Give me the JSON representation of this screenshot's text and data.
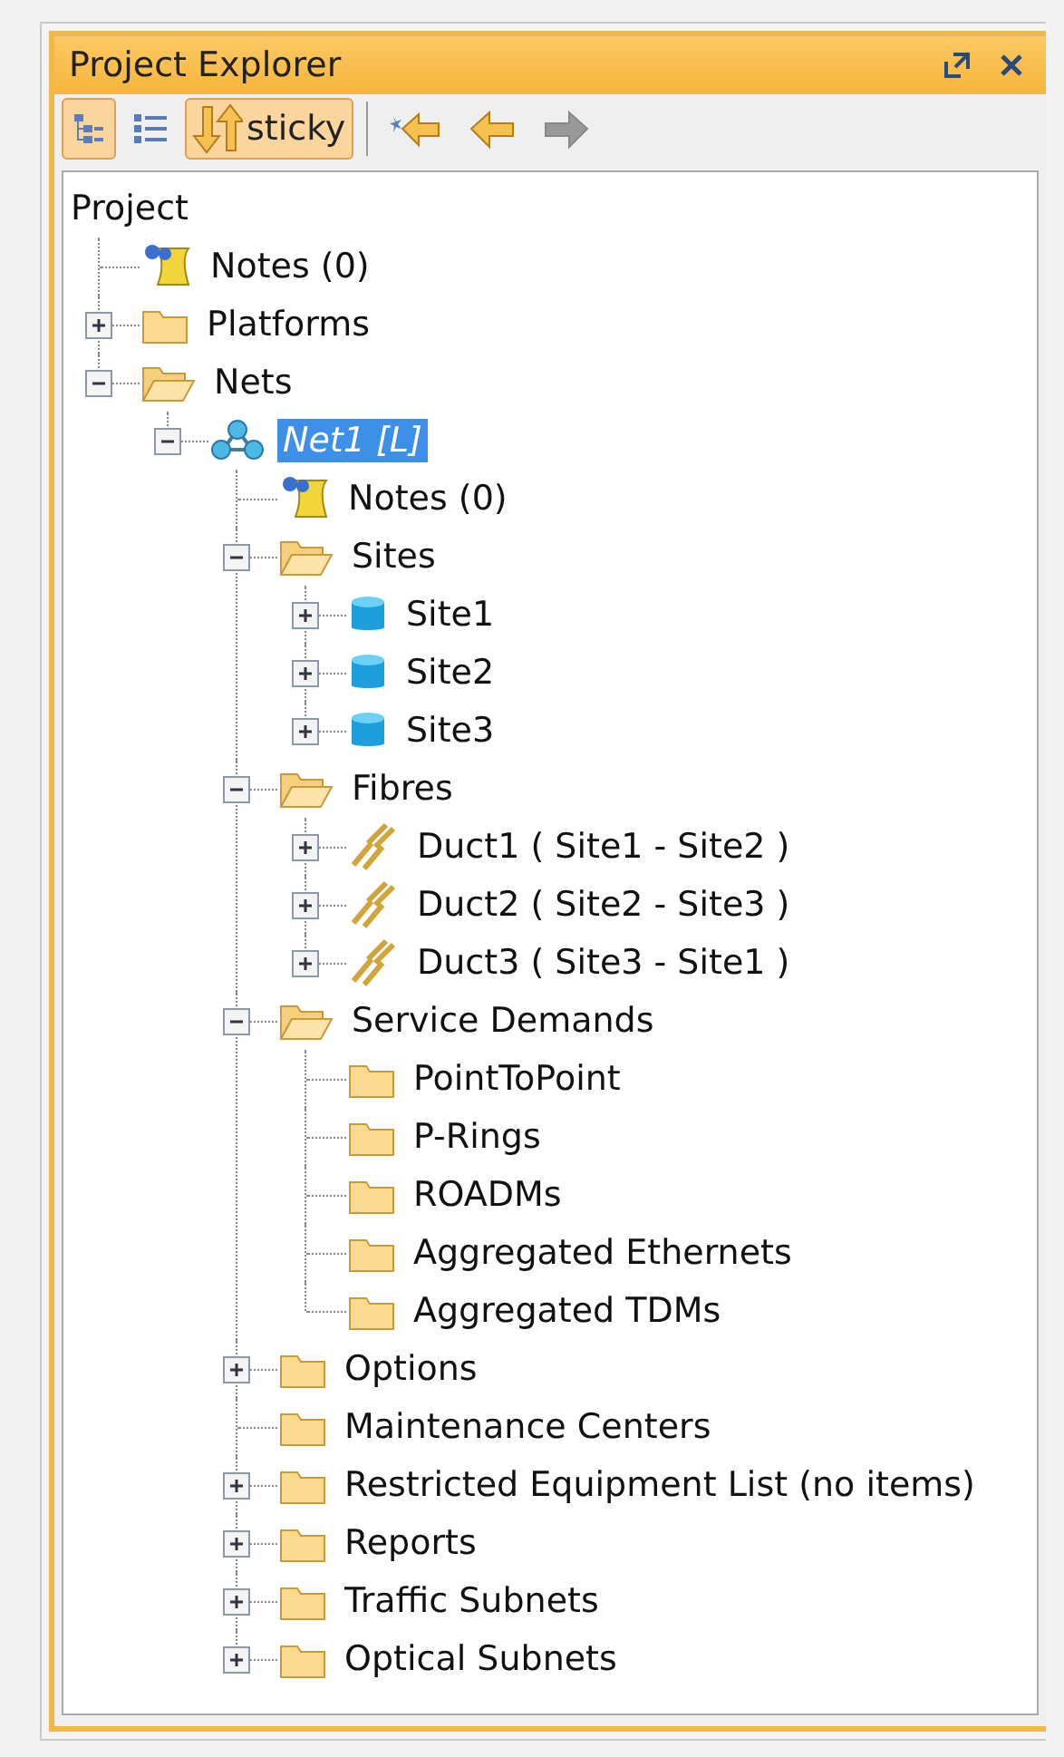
{
  "panel": {
    "title": "Project Explorer"
  },
  "view_buttons": [
    {
      "kind": "tree-view",
      "pressed": true
    },
    {
      "kind": "list-view",
      "pressed": false
    },
    {
      "kind": "sort",
      "pressed": true,
      "label": "sticky"
    }
  ],
  "nav_buttons": [
    {
      "kind": "back-new",
      "disabled": false
    },
    {
      "kind": "back",
      "disabled": false
    },
    {
      "kind": "forward",
      "disabled": true
    }
  ],
  "tree": {
    "root": "Project",
    "children": [
      {
        "label": "Notes (0)",
        "kind": "notes",
        "selected": false
      },
      {
        "label": "Platforms",
        "kind": "folder",
        "expanded": false,
        "selected": false
      },
      {
        "label": "Nets",
        "kind": "folder",
        "expanded": true,
        "selected": false,
        "children": [
          {
            "label": "Net1 [L]",
            "kind": "network",
            "expanded": true,
            "selected": true,
            "children": [
              {
                "label": "Notes (0)",
                "kind": "notes",
                "selected": false
              },
              {
                "label": "Sites",
                "kind": "folder",
                "expanded": true,
                "selected": false,
                "children": [
                  {
                    "label": "Site1",
                    "kind": "site",
                    "expanded": false,
                    "selected": false
                  },
                  {
                    "label": "Site2",
                    "kind": "site",
                    "expanded": false,
                    "selected": false
                  },
                  {
                    "label": "Site3",
                    "kind": "site",
                    "expanded": false,
                    "selected": false
                  }
                ]
              },
              {
                "label": "Fibres",
                "kind": "folder",
                "expanded": true,
                "selected": false,
                "children": [
                  {
                    "label": "Duct1 ( Site1 - Site2 )",
                    "kind": "duct",
                    "expanded": false,
                    "selected": false
                  },
                  {
                    "label": "Duct2 ( Site2 - Site3 )",
                    "kind": "duct",
                    "expanded": false,
                    "selected": false
                  },
                  {
                    "label": "Duct3 ( Site3 - Site1 )",
                    "kind": "duct",
                    "expanded": false,
                    "selected": false
                  }
                ]
              },
              {
                "label": "Service Demands",
                "kind": "folder",
                "expanded": true,
                "selected": false,
                "children": [
                  {
                    "label": "PointToPoint",
                    "kind": "folder",
                    "selected": false
                  },
                  {
                    "label": "P-Rings",
                    "kind": "folder",
                    "selected": false
                  },
                  {
                    "label": "ROADMs",
                    "kind": "folder",
                    "selected": false
                  },
                  {
                    "label": "Aggregated Ethernets",
                    "kind": "folder",
                    "selected": false
                  },
                  {
                    "label": "Aggregated TDMs",
                    "kind": "folder",
                    "selected": false
                  }
                ]
              },
              {
                "label": "Options",
                "kind": "folder",
                "expanded": false,
                "selected": false
              },
              {
                "label": "Maintenance Centers",
                "kind": "folder",
                "selected": false
              },
              {
                "label": "Restricted Equipment List (no items)",
                "kind": "folder",
                "expanded": false,
                "selected": false
              },
              {
                "label": "Reports",
                "kind": "folder",
                "expanded": false,
                "selected": false
              },
              {
                "label": "Traffic Subnets",
                "kind": "folder",
                "expanded": false,
                "selected": false
              },
              {
                "label": "Optical Subnets",
                "kind": "folder",
                "expanded": false,
                "selected": false
              }
            ]
          }
        ]
      }
    ]
  }
}
